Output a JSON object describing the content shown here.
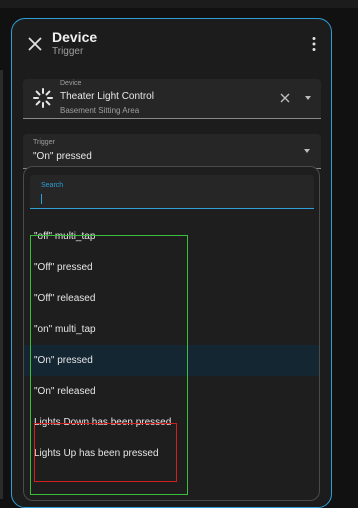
{
  "dialog": {
    "title": "Device",
    "subtitle": "Trigger"
  },
  "device_field": {
    "label": "Device",
    "value": "Theater Light Control",
    "secondary": "Basement Sitting Area"
  },
  "trigger_field": {
    "label": "Trigger",
    "value": "\"On\" pressed"
  },
  "search": {
    "label": "Search"
  },
  "options": [
    "\"off\" multi_tap",
    "\"Off\" pressed",
    "\"Off\" released",
    "\"on\" multi_tap",
    "\"On\" pressed",
    "\"On\" released",
    "Lights Down has been pressed",
    "Lights Up has been pressed"
  ],
  "selected_option": "\"On\" pressed",
  "colors": {
    "accent": "#2f9fd8",
    "highlight_green": "#3bbf3b",
    "highlight_red": "#d02020"
  }
}
